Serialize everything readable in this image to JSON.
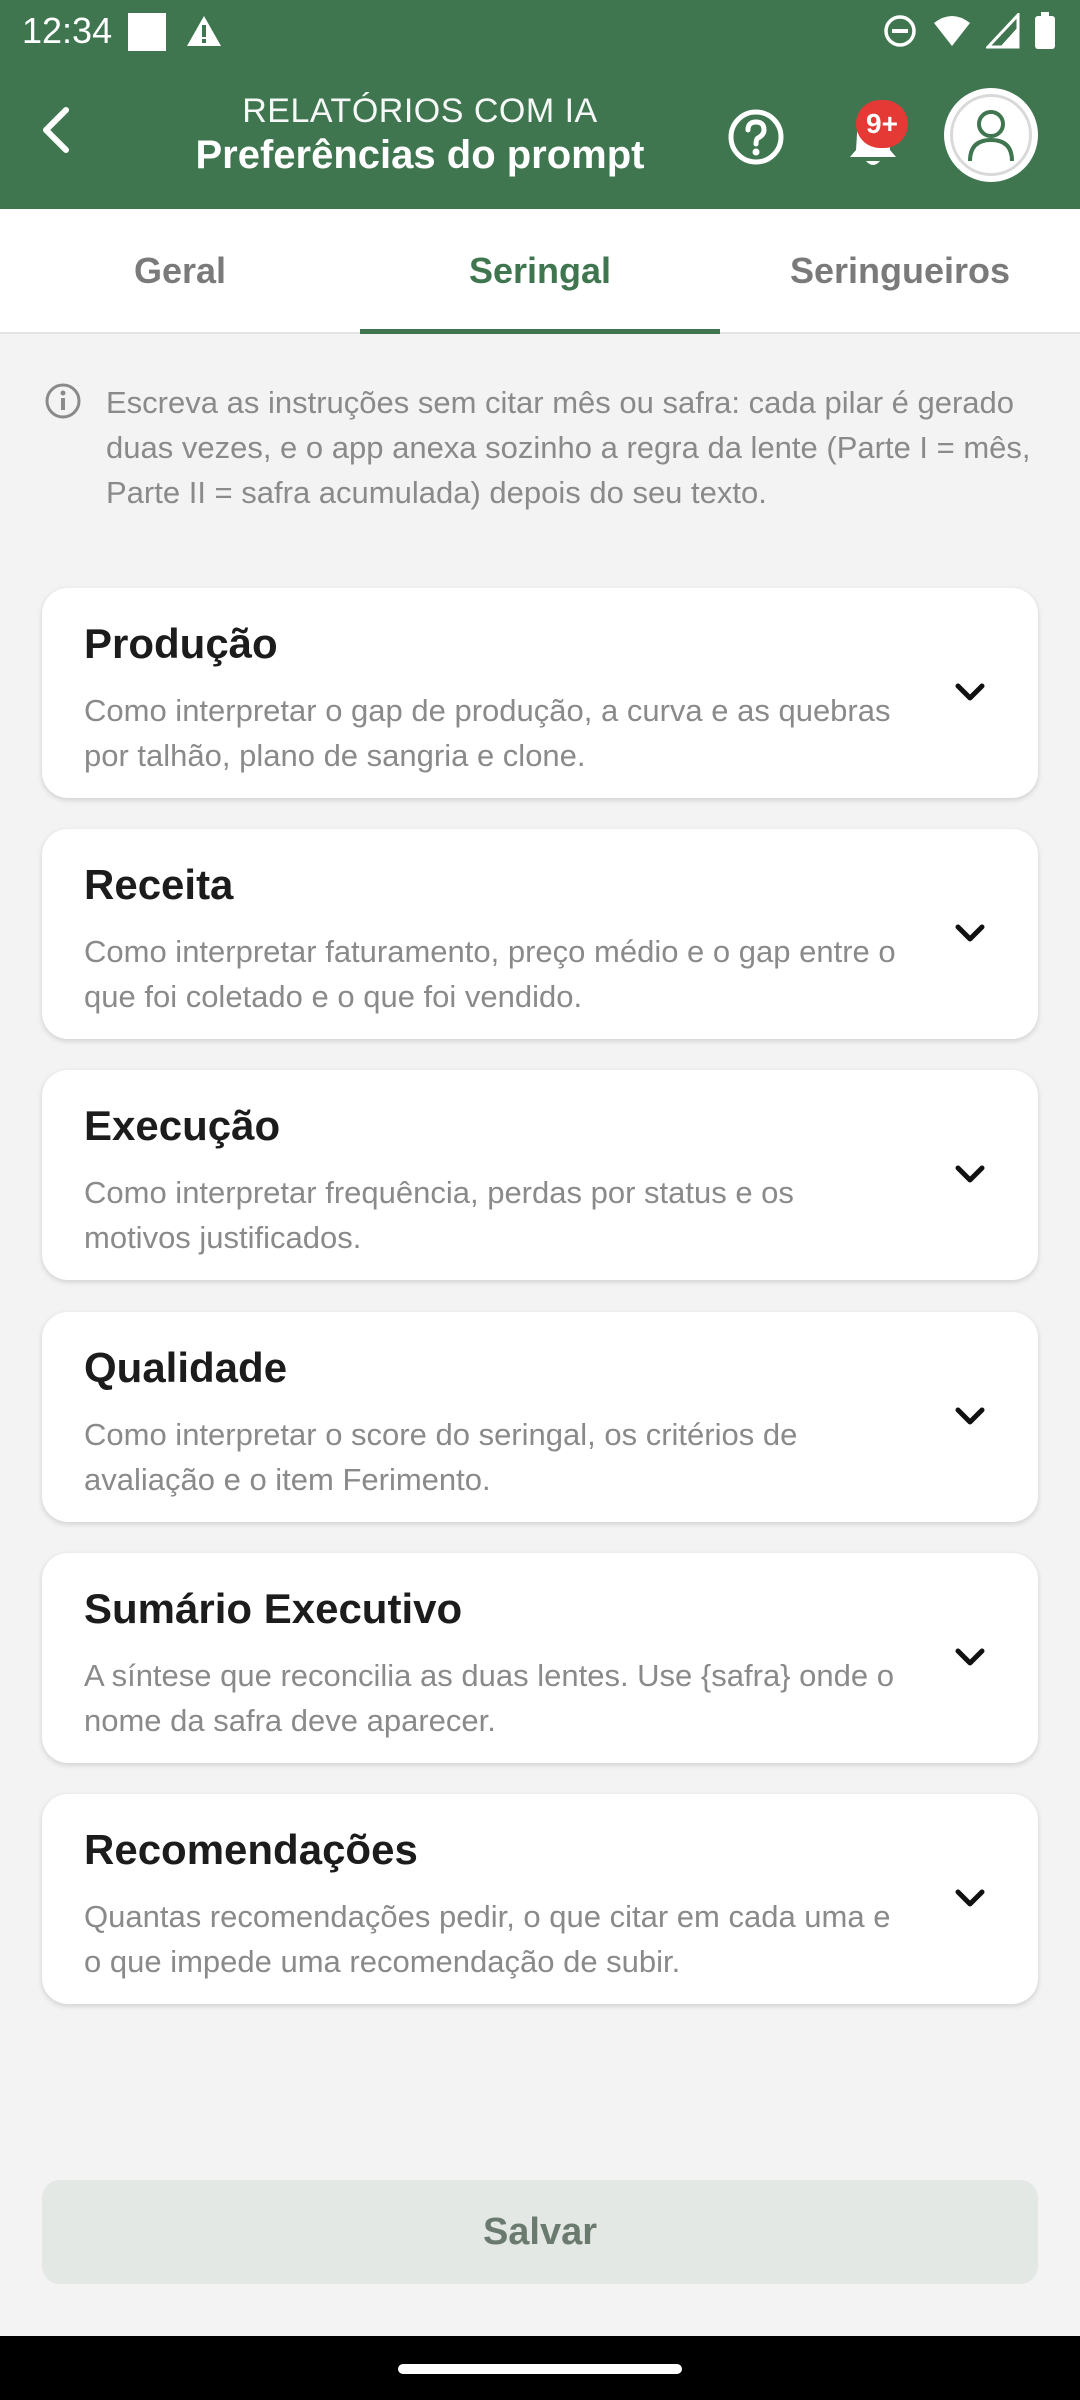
{
  "status_bar": {
    "time": "12:34"
  },
  "app_bar": {
    "subtitle": "RELATÓRIOS COM IA",
    "title": "Preferências do prompt",
    "notification_badge": "9+"
  },
  "tabs": [
    {
      "label": "Geral",
      "active": false
    },
    {
      "label": "Seringal",
      "active": true
    },
    {
      "label": "Seringueiros",
      "active": false
    }
  ],
  "info_text": "Escreva as instruções sem citar mês ou safra: cada pilar é gerado duas vezes, e o app anexa sozinho a regra da lente (Parte I = mês, Parte II = safra acumulada) depois do seu texto.",
  "sections": [
    {
      "title": "Produção",
      "description": "Como interpretar o gap de produção, a curva e as quebras por talhão, plano de sangria e clone."
    },
    {
      "title": "Receita",
      "description": "Como interpretar faturamento, preço médio e o gap entre o que foi coletado e o que foi vendido."
    },
    {
      "title": "Execução",
      "description": "Como interpretar frequência, perdas por status e os motivos justificados."
    },
    {
      "title": "Qualidade",
      "description": "Como interpretar o score do seringal, os critérios de avaliação e o item Ferimento."
    },
    {
      "title": "Sumário Executivo",
      "description": "A síntese que reconcilia as duas lentes. Use {safra} onde o nome da safra deve aparecer."
    },
    {
      "title": "Recomendações",
      "description": "Quantas recomendações pedir, o que citar em cada uma e o que impede uma recomendação de subir."
    }
  ],
  "save_label": "Salvar",
  "colors": {
    "primary": "#3f7650",
    "badge": "#e53935",
    "background": "#f3f3f3",
    "muted_text": "#8a8a8a"
  }
}
